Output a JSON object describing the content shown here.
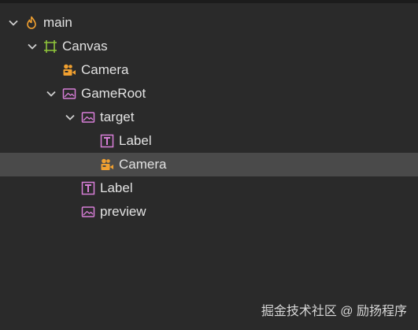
{
  "hierarchy": {
    "nodes": [
      {
        "label": "main",
        "icon": "scene-flame-icon",
        "expanded": true,
        "level": 0
      },
      {
        "label": "Canvas",
        "icon": "canvas-frame-icon",
        "expanded": true,
        "level": 1
      },
      {
        "label": "Camera",
        "icon": "camera-icon",
        "level": 2
      },
      {
        "label": "GameRoot",
        "icon": "sprite-image-icon",
        "expanded": true,
        "level": 2
      },
      {
        "label": "target",
        "icon": "sprite-image-icon",
        "expanded": true,
        "level": 3
      },
      {
        "label": "Label",
        "icon": "text-label-icon",
        "level": 4
      },
      {
        "label": "Camera",
        "icon": "camera-icon",
        "level": 4,
        "selected": true
      },
      {
        "label": "Label",
        "icon": "text-label-icon",
        "level": 3
      },
      {
        "label": "preview",
        "icon": "sprite-image-icon",
        "level": 3
      }
    ]
  },
  "watermark": "掘金技术社区 @ 励扬程序",
  "colors": {
    "background": "#2a2a2a",
    "selected_row": "#4a4a4a",
    "text": "#e2e2e2",
    "canvas_green": "#8fc63b",
    "orange": "#f0a030",
    "pink": "#d77ed7"
  }
}
